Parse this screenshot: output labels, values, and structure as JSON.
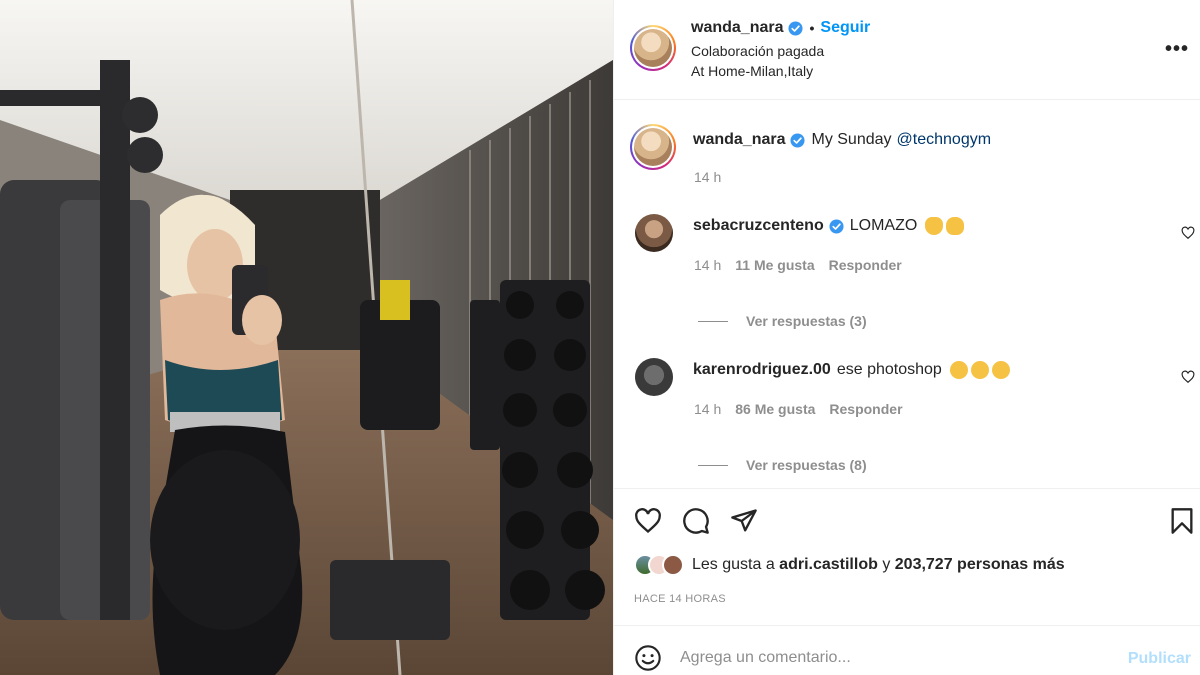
{
  "post": {
    "username": "wanda_nara",
    "follow_label": "Seguir",
    "separator": "•",
    "paid_partnership": "Colaboración pagada",
    "location": "At Home-Milan,Italy",
    "more_label": "•••"
  },
  "caption": {
    "username": "wanda_nara",
    "text": "My Sunday ",
    "mention": "@technogym",
    "time": "14 h"
  },
  "comments": [
    {
      "username": "sebacruzcenteno",
      "text": "LOMAZO",
      "emoji_icons": [
        "clapping-hands-icon",
        "raising-hands-icon"
      ],
      "time": "14 h",
      "likes": "11 Me gusta",
      "reply_label": "Responder",
      "view_replies": "Ver respuestas (3)"
    },
    {
      "username": "karenrodriguez.00",
      "text": "ese photoshop",
      "emoji_icons": [
        "laughing-tears-icon",
        "laughing-tears-icon",
        "laughing-tears-icon"
      ],
      "time": "14 h",
      "likes": "86 Me gusta",
      "reply_label": "Responder",
      "view_replies": "Ver respuestas (8)"
    }
  ],
  "likes_summary": {
    "prefix": "Les gusta a ",
    "user": "adri.castillob",
    "connector": " y ",
    "count": "203,727 personas más"
  },
  "posted_ago": "HACE 14 HORAS",
  "add_comment": {
    "placeholder": "Agrega un comentario...",
    "publish_label": "Publicar"
  },
  "colors": {
    "link_blue": "#0095f6",
    "mention_blue": "#00376b",
    "muted": "#8e8e8e",
    "publish_disabled": "#b2dffc"
  }
}
